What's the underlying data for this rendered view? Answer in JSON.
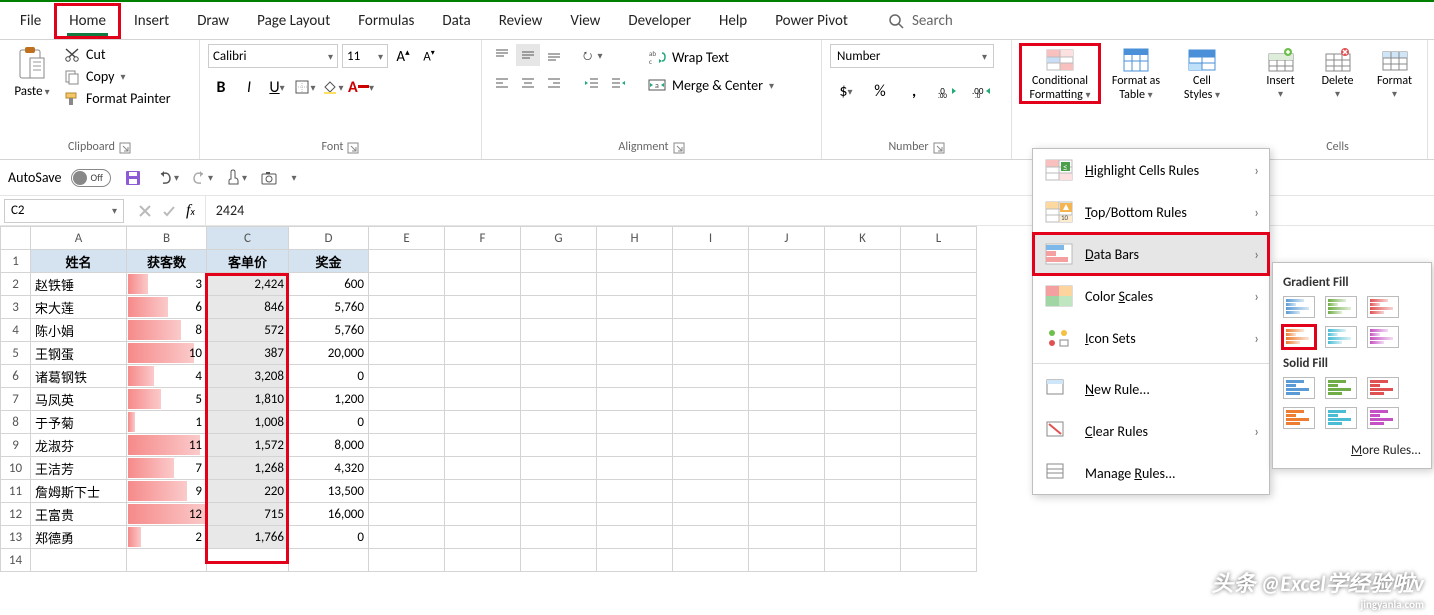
{
  "tabs": {
    "file": "File",
    "home": "Home",
    "insert": "Insert",
    "draw": "Draw",
    "page_layout": "Page Layout",
    "formulas": "Formulas",
    "data": "Data",
    "review": "Review",
    "view": "View",
    "developer": "Developer",
    "help": "Help",
    "power_pivot": "Power Pivot",
    "search": "Search"
  },
  "ribbon": {
    "clipboard": {
      "label": "Clipboard",
      "paste": "Paste",
      "cut": "Cut",
      "copy": "Copy",
      "format_painter": "Format Painter"
    },
    "font": {
      "label": "Font",
      "name": "Calibri",
      "size": "11"
    },
    "alignment": {
      "label": "Alignment",
      "wrap": "Wrap Text",
      "merge": "Merge & Center"
    },
    "number": {
      "label": "Number",
      "format": "Number"
    },
    "styles": {
      "cf": "Conditional Formatting",
      "cf1": "Conditional",
      "cf2": "Formatting",
      "fat": "Format as Table",
      "fat1": "Format as",
      "fat2": "Table",
      "cs": "Cell Styles",
      "cs1": "Cell",
      "cs2": "Styles"
    },
    "cells": {
      "label": "Cells",
      "insert": "Insert",
      "delete": "Delete",
      "format": "Format"
    }
  },
  "qat": {
    "autosave": "AutoSave",
    "autosave_state": "Off"
  },
  "formula": {
    "namebox": "C2",
    "value": "2424"
  },
  "grid": {
    "columns": [
      "A",
      "B",
      "C",
      "D",
      "E",
      "F",
      "G",
      "H",
      "I",
      "J",
      "K",
      "L"
    ],
    "headers": {
      "A": "姓名",
      "B": "获客数",
      "C": "客单价",
      "D": "奖金"
    },
    "rows": [
      {
        "name": "赵铁锤",
        "b": 3,
        "c": "2,424",
        "d": "600"
      },
      {
        "name": "宋大莲",
        "b": 6,
        "c": "846",
        "d": "5,760"
      },
      {
        "name": "陈小娟",
        "b": 8,
        "c": "572",
        "d": "5,760"
      },
      {
        "name": "王钢蛋",
        "b": 10,
        "c": "387",
        "d": "20,000"
      },
      {
        "name": "诸葛钢铁",
        "b": 4,
        "c": "3,208",
        "d": "0"
      },
      {
        "name": "马凤英",
        "b": 5,
        "c": "1,810",
        "d": "1,200"
      },
      {
        "name": "于予菊",
        "b": 1,
        "c": "1,008",
        "d": "0"
      },
      {
        "name": "龙淑芬",
        "b": 11,
        "c": "1,572",
        "d": "8,000"
      },
      {
        "name": "王洁芳",
        "b": 7,
        "c": "1,268",
        "d": "4,320"
      },
      {
        "name": "詹姆斯下士",
        "b": 9,
        "c": "220",
        "d": "13,500"
      },
      {
        "name": "王富贵",
        "b": 12,
        "c": "715",
        "d": "16,000"
      },
      {
        "name": "郑德勇",
        "b": 2,
        "c": "1,766",
        "d": "0"
      }
    ],
    "max_b": 12
  },
  "cf_menu": {
    "hcr": "Highlight Cells Rules",
    "tbr": "Top/Bottom Rules",
    "db": "Data Bars",
    "cs": "Color Scales",
    "is": "Icon Sets",
    "new": "New Rule...",
    "clear": "Clear Rules",
    "manage": "Manage Rules..."
  },
  "db_sub": {
    "grad": "Gradient Fill",
    "solid": "Solid Fill",
    "more": "More Rules..."
  },
  "watermark": {
    "main": "头条 @Excel学经验啦v",
    "sub": "jingyanla.com"
  },
  "chart_data": {
    "type": "table",
    "columns": [
      "姓名",
      "获客数",
      "客单价",
      "奖金"
    ],
    "rows": [
      [
        "赵铁锤",
        3,
        2424,
        600
      ],
      [
        "宋大莲",
        6,
        846,
        5760
      ],
      [
        "陈小娟",
        8,
        572,
        5760
      ],
      [
        "王钢蛋",
        10,
        387,
        20000
      ],
      [
        "诸葛钢铁",
        4,
        3208,
        0
      ],
      [
        "马凤英",
        5,
        1810,
        1200
      ],
      [
        "于予菊",
        1,
        1008,
        0
      ],
      [
        "龙淑芬",
        11,
        1572,
        8000
      ],
      [
        "王洁芳",
        7,
        1268,
        4320
      ],
      [
        "詹姆斯下士",
        9,
        220,
        13500
      ],
      [
        "王富贵",
        12,
        715,
        16000
      ],
      [
        "郑德勇",
        2,
        1766,
        0
      ]
    ]
  }
}
